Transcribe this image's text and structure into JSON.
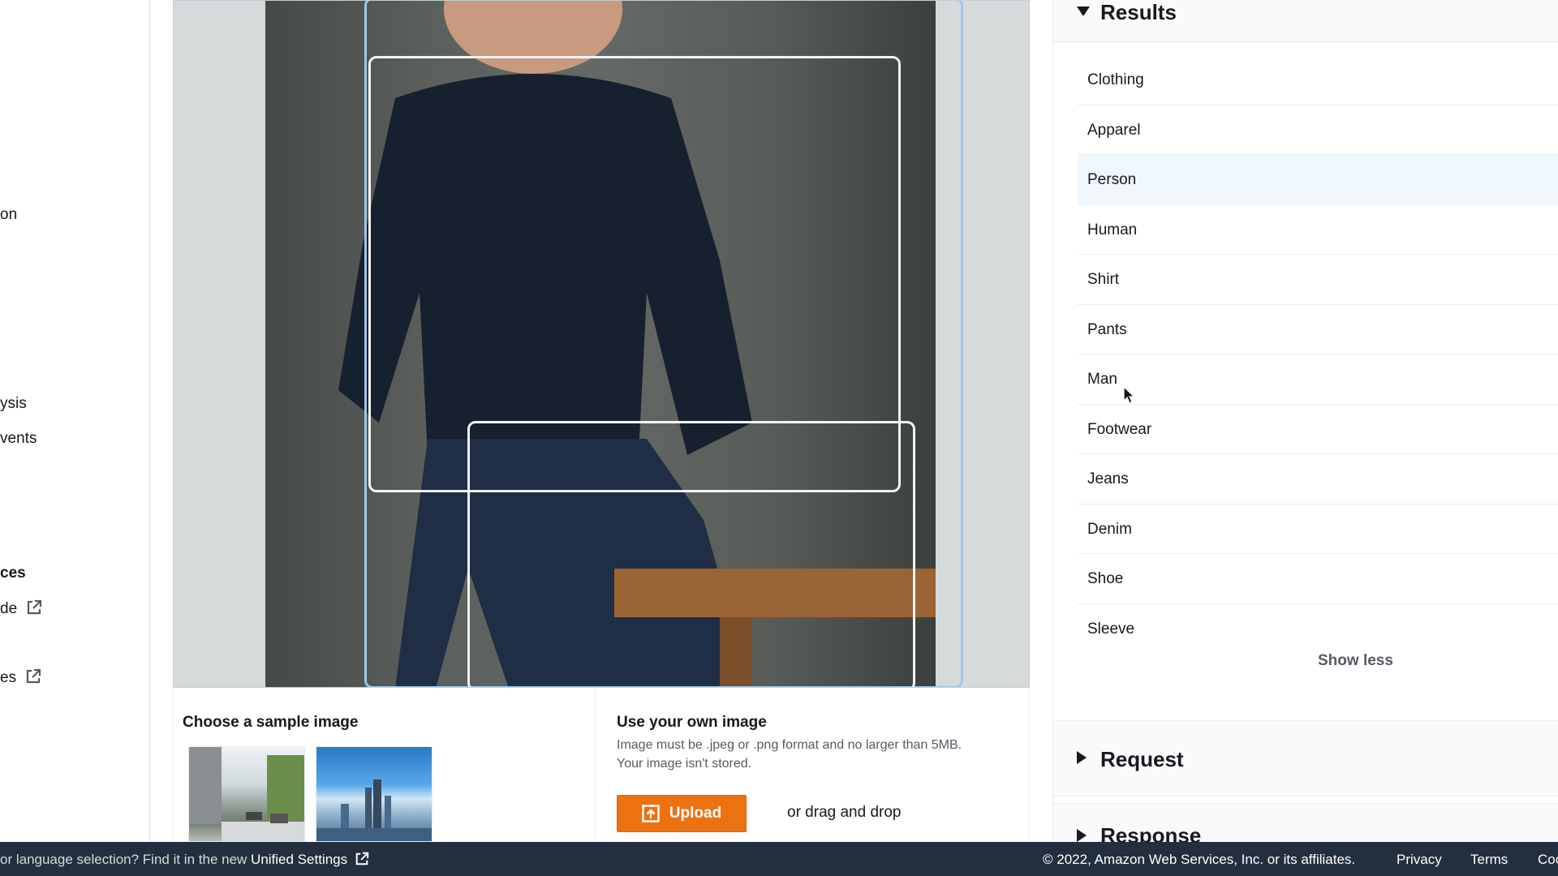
{
  "left_nav": {
    "items": [
      {
        "label": "on"
      },
      {
        "label": "ysis"
      },
      {
        "label": "vents"
      },
      {
        "label": "ces"
      },
      {
        "label": "de"
      },
      {
        "label": "es"
      }
    ]
  },
  "sample_panel": {
    "title": "Choose a sample image"
  },
  "own_image_panel": {
    "title": "Use your own image",
    "help_line1": "Image must be .jpeg or .png format and no larger than 5MB.",
    "help_line2": "Your image isn't stored.",
    "upload_label": "Upload",
    "drag_label": "or drag and drop"
  },
  "results": {
    "title": "Results",
    "labels": [
      "Clothing",
      "Apparel",
      "Person",
      "Human",
      "Shirt",
      "Pants",
      "Man",
      "Footwear",
      "Jeans",
      "Denim",
      "Shoe",
      "Sleeve"
    ],
    "show_less_label": "Show less"
  },
  "request_section": {
    "title": "Request"
  },
  "response_section": {
    "title": "Response"
  },
  "footer": {
    "settings_prompt": "or language selection? Find it in the new",
    "settings_link": "Unified Settings",
    "copyright": "© 2022, Amazon Web Services, Inc. or its affiliates.",
    "privacy": "Privacy",
    "terms": "Terms",
    "cookies_clipped": "Coo"
  },
  "colors": {
    "accent": "#ec7211",
    "footer_bg": "#232f3e",
    "highlight_row": "#f1f8fd"
  }
}
